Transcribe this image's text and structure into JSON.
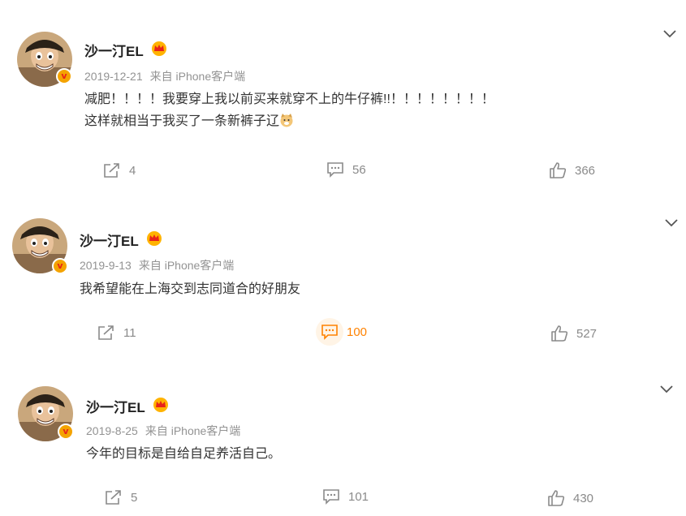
{
  "posts": [
    {
      "author": "沙一汀EL",
      "date": "2019-12-21",
      "source": "来自 iPhone客户端",
      "lines": [
        "减肥！！！！我要穿上我以前买来就穿不上的牛仔裤!!！！！！！！！！",
        "这样就相当于我买了一条新裤子辽"
      ],
      "repost_count": "4",
      "comment_count": "56",
      "like_count": "366"
    },
    {
      "author": "沙一汀EL",
      "date": "2019-9-13",
      "source": "来自 iPhone客户端",
      "lines": [
        "我希望能在上海交到志同道合的好朋友"
      ],
      "repost_count": "11",
      "comment_count": "100",
      "like_count": "527"
    },
    {
      "author": "沙一汀EL",
      "date": "2019-8-25",
      "source": "来自 iPhone客户端",
      "lines": [
        "今年的目标是自给自足养活自己。"
      ],
      "repost_count": "5",
      "comment_count": "101",
      "like_count": "430"
    }
  ],
  "icons": {
    "avatar": "luffy-avatar",
    "verified": "verified-v-icon",
    "member": "member-crown-icon",
    "emoji": "doge-emoji-icon",
    "expand": "chevron-down-icon",
    "repost": "repost-icon",
    "comment": "comment-icon",
    "like": "like-icon"
  },
  "colors": {
    "accent": "#ff8200",
    "muted": "#939393",
    "verified": "#f4a300"
  }
}
